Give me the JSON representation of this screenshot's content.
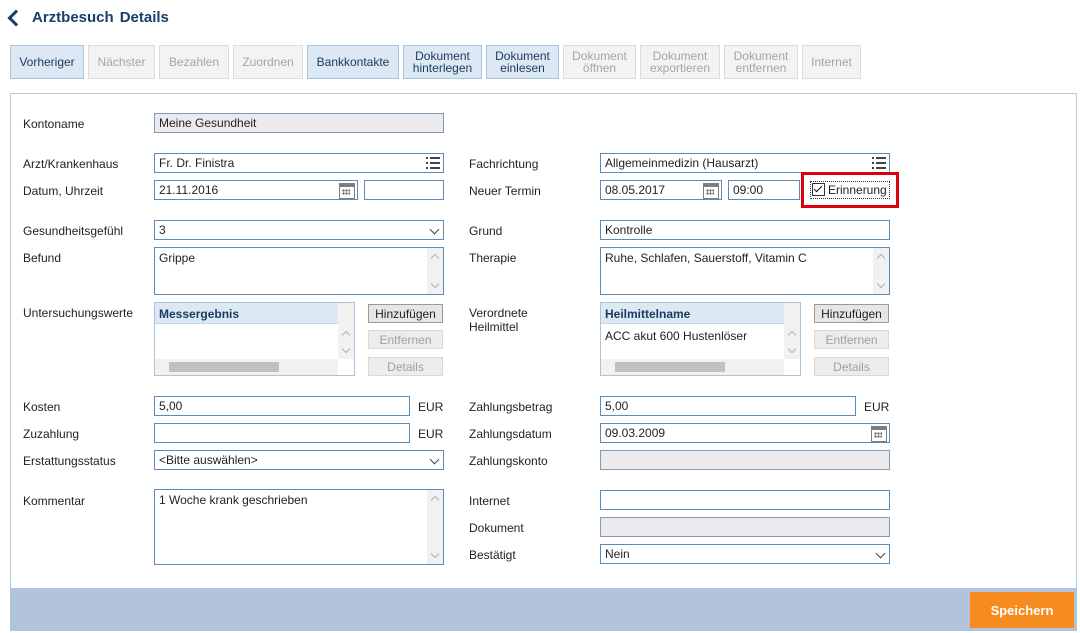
{
  "header": {
    "title": "Arztbesuch",
    "subtitle": "Details"
  },
  "toolbar": [
    {
      "label": "Vorheriger",
      "enabled": true
    },
    {
      "label": "Nächster",
      "enabled": false
    },
    {
      "label": "Bezahlen",
      "enabled": false
    },
    {
      "label": "Zuordnen",
      "enabled": false
    },
    {
      "label": "Bankkontakte",
      "enabled": true
    },
    {
      "label": "Dokument hinterlegen",
      "enabled": true
    },
    {
      "label": "Dokument einlesen",
      "enabled": true
    },
    {
      "label": "Dokument öffnen",
      "enabled": false
    },
    {
      "label": "Dokument exportieren",
      "enabled": false
    },
    {
      "label": "Dokument entfernen",
      "enabled": false
    },
    {
      "label": "Internet",
      "enabled": false
    }
  ],
  "form": {
    "kontoname": {
      "label": "Kontoname",
      "value": "Meine Gesundheit"
    },
    "arzt": {
      "label": "Arzt/Krankenhaus",
      "value": "Fr. Dr. Finistra"
    },
    "datum": {
      "label": "Datum, Uhrzeit",
      "date": "21.11.2016",
      "time": ""
    },
    "gesundheitsgefuehl": {
      "label": "Gesundheitsgefühl",
      "value": "3"
    },
    "befund": {
      "label": "Befund",
      "value": "Grippe"
    },
    "untersuchungswerte": {
      "label": "Untersuchungswerte",
      "column": "Messergebnis",
      "add": "Hinzufügen",
      "remove": "Entfernen",
      "details": "Details"
    },
    "kosten": {
      "label": "Kosten",
      "value": "5,00",
      "unit": "EUR"
    },
    "zuzahlung": {
      "label": "Zuzahlung",
      "value": "",
      "unit": "EUR"
    },
    "erstattungsstatus": {
      "label": "Erstattungsstatus",
      "value": "<Bitte auswählen>"
    },
    "kommentar": {
      "label": "Kommentar",
      "value": "1 Woche krank geschrieben"
    },
    "fachrichtung": {
      "label": "Fachrichtung",
      "value": "Allgemeinmedizin (Hausarzt)"
    },
    "termin": {
      "label": "Neuer Termin",
      "date": "08.05.2017",
      "time": "09:00",
      "reminder_label": "Erinnerung",
      "reminder_checked": true
    },
    "grund": {
      "label": "Grund",
      "value": "Kontrolle"
    },
    "therapie": {
      "label": "Therapie",
      "value": "Ruhe, Schlafen, Sauerstoff, Vitamin C"
    },
    "heilmittel": {
      "label_line1": "Verordnete",
      "label_line2": "Heilmittel",
      "column": "Heilmittelname",
      "row": "ACC akut 600 Hustenlöser",
      "add": "Hinzufügen",
      "remove": "Entfernen",
      "details": "Details"
    },
    "zahlungsbetrag": {
      "label": "Zahlungsbetrag",
      "value": "5,00",
      "unit": "EUR"
    },
    "zahlungsdatum": {
      "label": "Zahlungsdatum",
      "value": "09.03.2009"
    },
    "zahlungskonto": {
      "label": "Zahlungskonto",
      "value": ""
    },
    "internet": {
      "label": "Internet",
      "value": ""
    },
    "dokument": {
      "label": "Dokument",
      "value": ""
    },
    "bestaetigt": {
      "label": "Bestätigt",
      "value": "Nein"
    }
  },
  "footer": {
    "save_label": "Speichern"
  },
  "colors": {
    "accent": "#f68b1f",
    "highlight": "#d9000f",
    "footer": "#b1c4dc"
  }
}
